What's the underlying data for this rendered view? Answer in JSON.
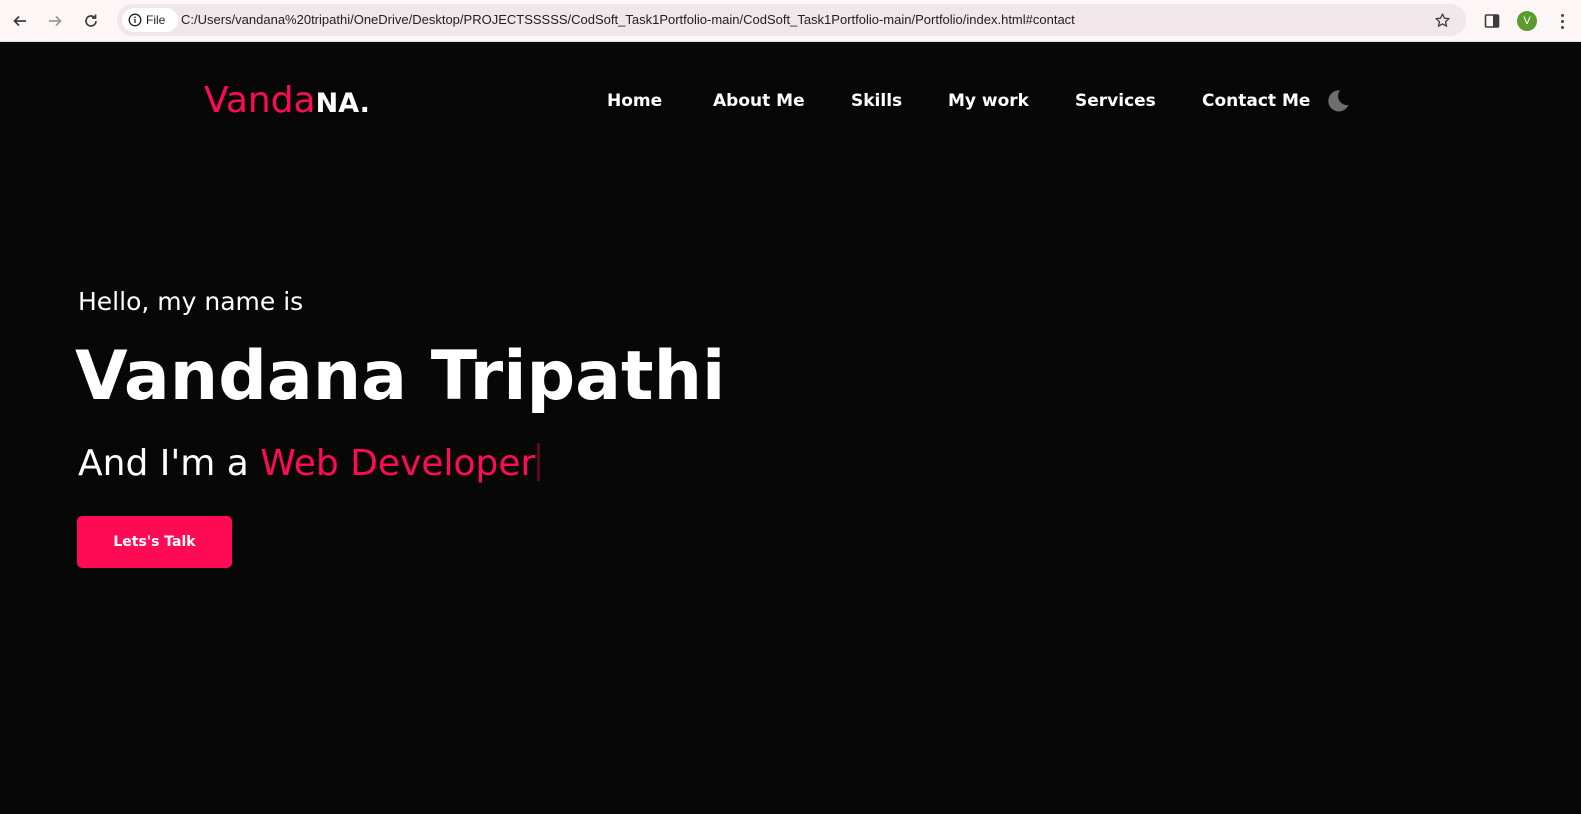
{
  "browser": {
    "scheme_label": "File",
    "url": "C:/Users/vandana%20tripathi/OneDrive/Desktop/PROJECTSSSSS/CodSoft_Task1Portfolio-main/CodSoft_Task1Portfolio-main/Portfolio/index.html#contact",
    "profile_initial": "V",
    "icons": [
      "back-icon",
      "forward-icon",
      "reload-icon",
      "info-icon",
      "star-icon",
      "side-panel-icon",
      "more-menu-icon"
    ]
  },
  "header": {
    "logo_accent": "Vanda",
    "logo_rest": "NA.",
    "menu": [
      "Home",
      "About Me",
      "Skills",
      "My work",
      "Services",
      "Contact Me"
    ],
    "theme_icon": "moon-icon"
  },
  "hero": {
    "greeting": "Hello, my name is",
    "name": "Vandana Tripathi",
    "tagline_prefix": "And I'm a ",
    "tagline_role": "Web Developer",
    "cta_label": "Lets's Talk"
  },
  "colors": {
    "accent": "#ff0a54",
    "background": "#070707",
    "text": "#ffffff"
  }
}
